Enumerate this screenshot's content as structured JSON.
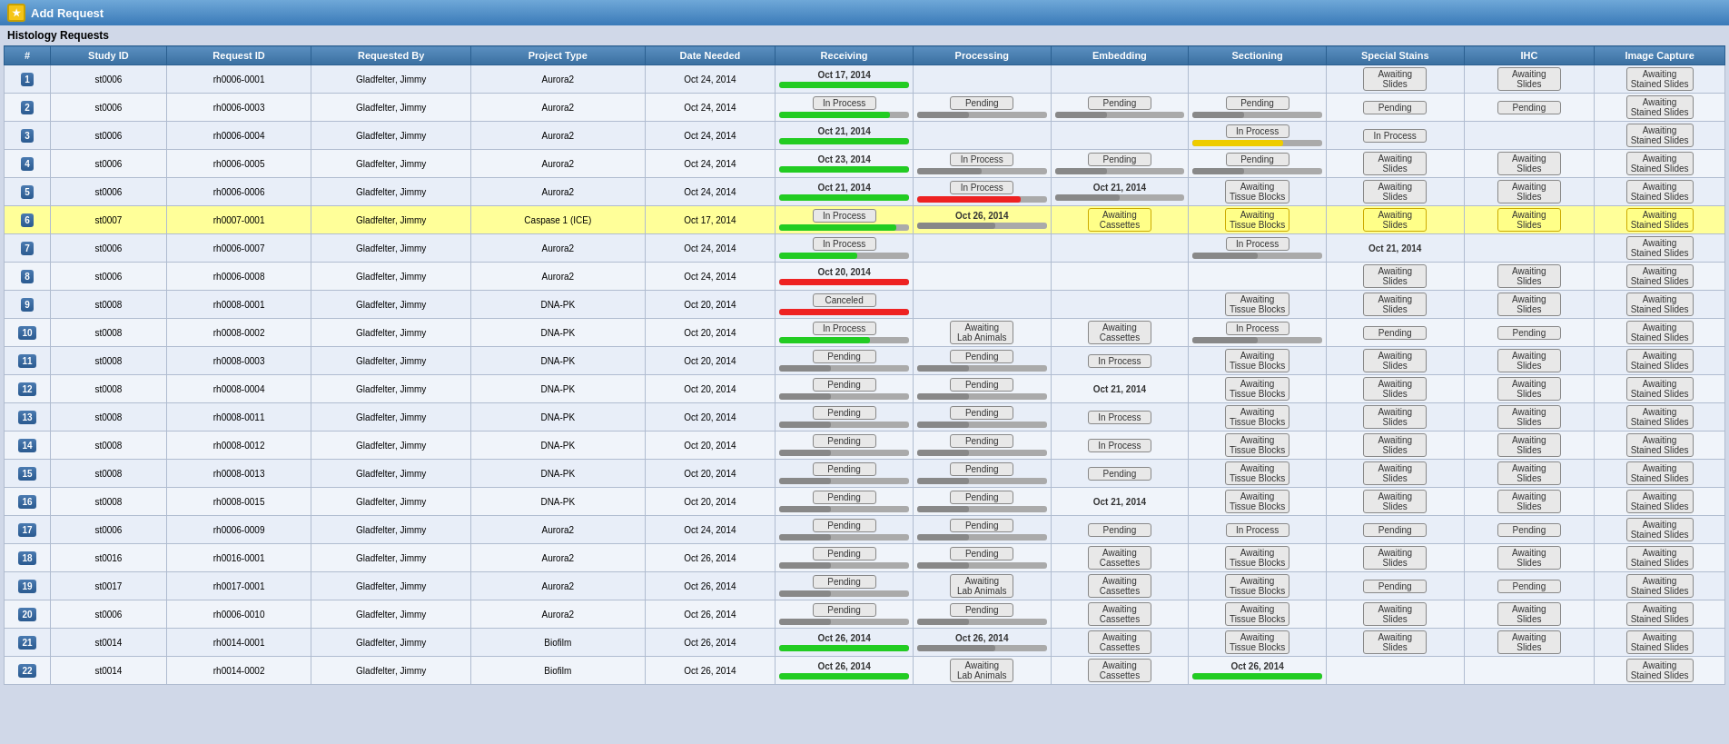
{
  "titleBar": {
    "icon": "★",
    "title": "Add Request"
  },
  "pageTitle": "Histology Requests",
  "headers": {
    "num": "#",
    "studyId": "Study ID",
    "requestId": "Request ID",
    "requestedBy": "Requested By",
    "projectType": "Project Type",
    "dateNeeded": "Date Needed",
    "receiving": "Receiving",
    "processing": "Processing",
    "embedding": "Embedding",
    "sectioning": "Sectioning",
    "specialStains": "Special Stains",
    "ihc": "IHC",
    "imageCapture": "Image Capture"
  },
  "rows": [
    {
      "num": 1,
      "studyId": "st0006",
      "requestId": "rh0006-0001",
      "requestedBy": "Gladfelter, Jimmy",
      "projectType": "Aurora2",
      "dateNeeded": "Oct 24, 2014",
      "receiving": {
        "date": "Oct 17, 2014",
        "barColor": "green",
        "barPct": 100
      },
      "processing": {
        "label": "",
        "barColor": "none",
        "barPct": 0
      },
      "embedding": {
        "label": "",
        "barColor": "none",
        "barPct": 0
      },
      "sectioning": {
        "label": "",
        "barColor": "none",
        "barPct": 0
      },
      "specialStains": {
        "label": "Awaiting\nSlides"
      },
      "ihc": {
        "label": "Awaiting\nSlides"
      },
      "imageCapture": {
        "label": "Awaiting\nStained Slides"
      }
    },
    {
      "num": 2,
      "studyId": "st0006",
      "requestId": "rh0006-0003",
      "requestedBy": "Gladfelter, Jimmy",
      "projectType": "Aurora2",
      "dateNeeded": "Oct 24, 2014",
      "receiving": {
        "label": "In Process",
        "barColor": "green",
        "barPct": 85
      },
      "processing": {
        "label": "Pending",
        "barColor": "gray",
        "barPct": 40
      },
      "embedding": {
        "label": "Pending",
        "barColor": "gray",
        "barPct": 40
      },
      "sectioning": {
        "label": "Pending",
        "barColor": "gray",
        "barPct": 40
      },
      "specialStains": {
        "label": "Pending"
      },
      "ihc": {
        "label": "Pending"
      },
      "imageCapture": {
        "label": "Awaiting\nStained Slides"
      }
    },
    {
      "num": 3,
      "studyId": "st0006",
      "requestId": "rh0006-0004",
      "requestedBy": "Gladfelter, Jimmy",
      "projectType": "Aurora2",
      "dateNeeded": "Oct 24, 2014",
      "receiving": {
        "date": "Oct 21, 2014",
        "barColor": "green",
        "barPct": 100
      },
      "processing": {
        "label": "",
        "barColor": "none",
        "barPct": 0
      },
      "embedding": {
        "label": "",
        "barColor": "none",
        "barPct": 0
      },
      "sectioning": {
        "label": "In Process",
        "barColor": "yellow",
        "barPct": 70
      },
      "specialStains": {
        "label": "In Process"
      },
      "ihc": {
        "label": ""
      },
      "imageCapture": {
        "label": "Awaiting\nStained Slides"
      }
    },
    {
      "num": 4,
      "studyId": "st0006",
      "requestId": "rh0006-0005",
      "requestedBy": "Gladfelter, Jimmy",
      "projectType": "Aurora2",
      "dateNeeded": "Oct 24, 2014",
      "receiving": {
        "date": "Oct 23, 2014",
        "barColor": "green",
        "barPct": 100
      },
      "processing": {
        "label": "In Process",
        "barColor": "gray",
        "barPct": 50
      },
      "embedding": {
        "label": "Pending",
        "barColor": "gray",
        "barPct": 40
      },
      "sectioning": {
        "label": "Pending",
        "barColor": "gray",
        "barPct": 40
      },
      "specialStains": {
        "label": "Awaiting\nSlides"
      },
      "ihc": {
        "label": "Awaiting\nSlides"
      },
      "imageCapture": {
        "label": "Awaiting\nStained Slides"
      }
    },
    {
      "num": 5,
      "studyId": "st0006",
      "requestId": "rh0006-0006",
      "requestedBy": "Gladfelter, Jimmy",
      "projectType": "Aurora2",
      "dateNeeded": "Oct 24, 2014",
      "receiving": {
        "date": "Oct 21, 2014",
        "barColor": "green",
        "barPct": 100
      },
      "processing": {
        "label": "In Process",
        "barColor": "red",
        "barPct": 80
      },
      "embedding": {
        "date": "Oct 21, 2014",
        "barColor": "gray",
        "barPct": 50
      },
      "sectioning": {
        "label": "Awaiting\nTissue Blocks"
      },
      "specialStains": {
        "label": "Awaiting\nSlides"
      },
      "ihc": {
        "label": "Awaiting\nSlides"
      },
      "imageCapture": {
        "label": "Awaiting\nStained Slides"
      }
    },
    {
      "num": 6,
      "studyId": "st0007",
      "requestId": "rh0007-0001",
      "requestedBy": "Gladfelter, Jimmy",
      "projectType": "Caspase 1 (ICE)",
      "dateNeeded": "Oct 17, 2014",
      "highlighted": true,
      "receiving": {
        "label": "In Process",
        "barColor": "green",
        "barPct": 90
      },
      "processing": {
        "date": "Oct 26, 2014",
        "barColor": "gray",
        "barPct": 60
      },
      "embedding": {
        "label": "Awaiting\nCassettes",
        "yellow": true
      },
      "sectioning": {
        "label": "Awaiting\nTissue Blocks",
        "yellow": true
      },
      "specialStains": {
        "label": "Awaiting\nSlides",
        "yellow": true
      },
      "ihc": {
        "label": "Awaiting\nSlides",
        "yellow": true
      },
      "imageCapture": {
        "label": "Awaiting\nStained Slides",
        "yellow": true
      }
    },
    {
      "num": 7,
      "studyId": "st0006",
      "requestId": "rh0006-0007",
      "requestedBy": "Gladfelter, Jimmy",
      "projectType": "Aurora2",
      "dateNeeded": "Oct 24, 2014",
      "receiving": {
        "label": "In Process",
        "barColor": "green",
        "barPct": 60
      },
      "processing": {
        "label": "",
        "barColor": "none"
      },
      "embedding": {
        "label": "",
        "barColor": "none"
      },
      "sectioning": {
        "label": "In Process",
        "barColor": "gray",
        "barPct": 50
      },
      "specialStains": {
        "date": "Oct 21, 2014"
      },
      "ihc": {
        "label": ""
      },
      "imageCapture": {
        "label": "Awaiting\nStained Slides"
      }
    },
    {
      "num": 8,
      "studyId": "st0006",
      "requestId": "rh0006-0008",
      "requestedBy": "Gladfelter, Jimmy",
      "projectType": "Aurora2",
      "dateNeeded": "Oct 24, 2014",
      "receiving": {
        "date": "Oct 20, 2014",
        "barColor": "red",
        "barPct": 100
      },
      "processing": {
        "label": "",
        "barColor": "none"
      },
      "embedding": {
        "label": "",
        "barColor": "none"
      },
      "sectioning": {
        "label": ""
      },
      "specialStains": {
        "label": "Awaiting\nSlides"
      },
      "ihc": {
        "label": "Awaiting\nSlides"
      },
      "imageCapture": {
        "label": "Awaiting\nStained Slides"
      }
    },
    {
      "num": 9,
      "studyId": "st0008",
      "requestId": "rh0008-0001",
      "requestedBy": "Gladfelter, Jimmy",
      "projectType": "DNA-PK",
      "dateNeeded": "Oct 20, 2014",
      "receiving": {
        "label": "Canceled",
        "barColor": "red",
        "barPct": 100
      },
      "processing": {
        "label": "",
        "barColor": "none"
      },
      "embedding": {
        "label": "",
        "barColor": "none"
      },
      "sectioning": {
        "label": "Awaiting\nTissue Blocks"
      },
      "specialStains": {
        "label": "Awaiting\nSlides"
      },
      "ihc": {
        "label": "Awaiting\nSlides"
      },
      "imageCapture": {
        "label": "Awaiting\nStained Slides"
      }
    },
    {
      "num": 10,
      "studyId": "st0008",
      "requestId": "rh0008-0002",
      "requestedBy": "Gladfelter, Jimmy",
      "projectType": "DNA-PK",
      "dateNeeded": "Oct 20, 2014",
      "receiving": {
        "label": "In Process",
        "barColor": "green",
        "barPct": 70
      },
      "processing": {
        "label": "Awaiting\nLab Animals"
      },
      "embedding": {
        "label": "Awaiting\nCassettes"
      },
      "sectioning": {
        "label": "In Process",
        "barColor": "gray",
        "barPct": 50
      },
      "specialStains": {
        "label": "Pending"
      },
      "ihc": {
        "label": "Pending"
      },
      "imageCapture": {
        "label": "Awaiting\nStained Slides"
      }
    },
    {
      "num": 11,
      "studyId": "st0008",
      "requestId": "rh0008-0003",
      "requestedBy": "Gladfelter, Jimmy",
      "projectType": "DNA-PK",
      "dateNeeded": "Oct 20, 2014",
      "receiving": {
        "label": "Pending",
        "barColor": "gray",
        "barPct": 40
      },
      "processing": {
        "label": "Pending",
        "barColor": "gray",
        "barPct": 40
      },
      "embedding": {
        "label": "In Process"
      },
      "sectioning": {
        "label": "Awaiting\nTissue Blocks"
      },
      "specialStains": {
        "label": "Awaiting\nSlides"
      },
      "ihc": {
        "label": "Awaiting\nSlides"
      },
      "imageCapture": {
        "label": "Awaiting\nStained Slides"
      }
    },
    {
      "num": 12,
      "studyId": "st0008",
      "requestId": "rh0008-0004",
      "requestedBy": "Gladfelter, Jimmy",
      "projectType": "DNA-PK",
      "dateNeeded": "Oct 20, 2014",
      "receiving": {
        "label": "Pending",
        "barColor": "gray",
        "barPct": 40
      },
      "processing": {
        "label": "Pending",
        "barColor": "gray",
        "barPct": 40
      },
      "embedding": {
        "date": "Oct 21, 2014"
      },
      "sectioning": {
        "label": "Awaiting\nTissue Blocks"
      },
      "specialStains": {
        "label": "Awaiting\nSlides"
      },
      "ihc": {
        "label": "Awaiting\nSlides"
      },
      "imageCapture": {
        "label": "Awaiting\nStained Slides"
      }
    },
    {
      "num": 13,
      "studyId": "st0008",
      "requestId": "rh0008-0011",
      "requestedBy": "Gladfelter, Jimmy",
      "projectType": "DNA-PK",
      "dateNeeded": "Oct 20, 2014",
      "receiving": {
        "label": "Pending",
        "barColor": "gray",
        "barPct": 40
      },
      "processing": {
        "label": "Pending",
        "barColor": "gray",
        "barPct": 40
      },
      "embedding": {
        "label": "In Process"
      },
      "sectioning": {
        "label": "Awaiting\nTissue Blocks"
      },
      "specialStains": {
        "label": "Awaiting\nSlides"
      },
      "ihc": {
        "label": "Awaiting\nSlides"
      },
      "imageCapture": {
        "label": "Awaiting\nStained Slides"
      }
    },
    {
      "num": 14,
      "studyId": "st0008",
      "requestId": "rh0008-0012",
      "requestedBy": "Gladfelter, Jimmy",
      "projectType": "DNA-PK",
      "dateNeeded": "Oct 20, 2014",
      "receiving": {
        "label": "Pending",
        "barColor": "gray",
        "barPct": 40
      },
      "processing": {
        "label": "Pending",
        "barColor": "gray",
        "barPct": 40
      },
      "embedding": {
        "label": "In Process"
      },
      "sectioning": {
        "label": "Awaiting\nTissue Blocks"
      },
      "specialStains": {
        "label": "Awaiting\nSlides"
      },
      "ihc": {
        "label": "Awaiting\nSlides"
      },
      "imageCapture": {
        "label": "Awaiting\nStained Slides"
      }
    },
    {
      "num": 15,
      "studyId": "st0008",
      "requestId": "rh0008-0013",
      "requestedBy": "Gladfelter, Jimmy",
      "projectType": "DNA-PK",
      "dateNeeded": "Oct 20, 2014",
      "receiving": {
        "label": "Pending",
        "barColor": "gray",
        "barPct": 40
      },
      "processing": {
        "label": "Pending",
        "barColor": "gray",
        "barPct": 40
      },
      "embedding": {
        "label": "Pending"
      },
      "sectioning": {
        "label": "Awaiting\nTissue Blocks"
      },
      "specialStains": {
        "label": "Awaiting\nSlides"
      },
      "ihc": {
        "label": "Awaiting\nSlides"
      },
      "imageCapture": {
        "label": "Awaiting\nStained Slides"
      }
    },
    {
      "num": 16,
      "studyId": "st0008",
      "requestId": "rh0008-0015",
      "requestedBy": "Gladfelter, Jimmy",
      "projectType": "DNA-PK",
      "dateNeeded": "Oct 20, 2014",
      "receiving": {
        "label": "Pending",
        "barColor": "gray",
        "barPct": 40
      },
      "processing": {
        "label": "Pending",
        "barColor": "gray",
        "barPct": 40
      },
      "embedding": {
        "date": "Oct 21, 2014"
      },
      "sectioning": {
        "label": "Awaiting\nTissue Blocks"
      },
      "specialStains": {
        "label": "Awaiting\nSlides"
      },
      "ihc": {
        "label": "Awaiting\nSlides"
      },
      "imageCapture": {
        "label": "Awaiting\nStained Slides"
      }
    },
    {
      "num": 17,
      "studyId": "st0006",
      "requestId": "rh0006-0009",
      "requestedBy": "Gladfelter, Jimmy",
      "projectType": "Aurora2",
      "dateNeeded": "Oct 24, 2014",
      "receiving": {
        "label": "Pending",
        "barColor": "gray",
        "barPct": 40
      },
      "processing": {
        "label": "Pending",
        "barColor": "gray",
        "barPct": 40
      },
      "embedding": {
        "label": "Pending"
      },
      "sectioning": {
        "label": "In Process"
      },
      "specialStains": {
        "label": "Pending"
      },
      "ihc": {
        "label": "Pending"
      },
      "imageCapture": {
        "label": "Awaiting\nStained Slides"
      }
    },
    {
      "num": 18,
      "studyId": "st0016",
      "requestId": "rh0016-0001",
      "requestedBy": "Gladfelter, Jimmy",
      "projectType": "Aurora2",
      "dateNeeded": "Oct 26, 2014",
      "receiving": {
        "label": "Pending",
        "barColor": "gray",
        "barPct": 40
      },
      "processing": {
        "label": "Pending",
        "barColor": "gray",
        "barPct": 40
      },
      "embedding": {
        "label": "Awaiting\nCassettes"
      },
      "sectioning": {
        "label": "Awaiting\nTissue Blocks"
      },
      "specialStains": {
        "label": "Awaiting\nSlides"
      },
      "ihc": {
        "label": "Awaiting\nSlides"
      },
      "imageCapture": {
        "label": "Awaiting\nStained Slides"
      }
    },
    {
      "num": 19,
      "studyId": "st0017",
      "requestId": "rh0017-0001",
      "requestedBy": "Gladfelter, Jimmy",
      "projectType": "Aurora2",
      "dateNeeded": "Oct 26, 2014",
      "receiving": {
        "label": "Pending",
        "barColor": "gray",
        "barPct": 40
      },
      "processing": {
        "label": "Awaiting\nLab Animals"
      },
      "embedding": {
        "label": "Awaiting\nCassettes"
      },
      "sectioning": {
        "label": "Awaiting\nTissue Blocks"
      },
      "specialStains": {
        "label": "Pending"
      },
      "ihc": {
        "label": "Pending"
      },
      "imageCapture": {
        "label": "Awaiting\nStained Slides"
      }
    },
    {
      "num": 20,
      "studyId": "st0006",
      "requestId": "rh0006-0010",
      "requestedBy": "Gladfelter, Jimmy",
      "projectType": "Aurora2",
      "dateNeeded": "Oct 26, 2014",
      "receiving": {
        "label": "Pending",
        "barColor": "gray",
        "barPct": 40
      },
      "processing": {
        "label": "Pending",
        "barColor": "gray",
        "barPct": 40
      },
      "embedding": {
        "label": "Awaiting\nCassettes"
      },
      "sectioning": {
        "label": "Awaiting\nTissue Blocks"
      },
      "specialStains": {
        "label": "Awaiting\nSlides"
      },
      "ihc": {
        "label": "Awaiting\nSlides"
      },
      "imageCapture": {
        "label": "Awaiting\nStained Slides"
      }
    },
    {
      "num": 21,
      "studyId": "st0014",
      "requestId": "rh0014-0001",
      "requestedBy": "Gladfelter, Jimmy",
      "projectType": "Biofilm",
      "dateNeeded": "Oct 26, 2014",
      "receiving": {
        "date": "Oct 26, 2014",
        "barColor": "green",
        "barPct": 100
      },
      "processing": {
        "date": "Oct 26, 2014",
        "barColor": "gray",
        "barPct": 60
      },
      "embedding": {
        "label": "Awaiting\nCassettes"
      },
      "sectioning": {
        "label": "Awaiting\nTissue Blocks"
      },
      "specialStains": {
        "label": "Awaiting\nSlides"
      },
      "ihc": {
        "label": "Awaiting\nSlides"
      },
      "imageCapture": {
        "label": "Awaiting\nStained Slides"
      }
    },
    {
      "num": 22,
      "studyId": "st0014",
      "requestId": "rh0014-0002",
      "requestedBy": "Gladfelter, Jimmy",
      "projectType": "Biofilm",
      "dateNeeded": "Oct 26, 2014",
      "receiving": {
        "date": "Oct 26, 2014",
        "barColor": "green",
        "barPct": 100
      },
      "processing": {
        "label": "Awaiting\nLab Animals"
      },
      "embedding": {
        "label": "Awaiting\nCassettes"
      },
      "sectioning": {
        "date": "Oct 26, 2014",
        "barColor": "green",
        "barPct": 100
      },
      "specialStains": {
        "label": ""
      },
      "ihc": {
        "label": ""
      },
      "imageCapture": {
        "label": "Awaiting\nStained Slides"
      }
    }
  ]
}
